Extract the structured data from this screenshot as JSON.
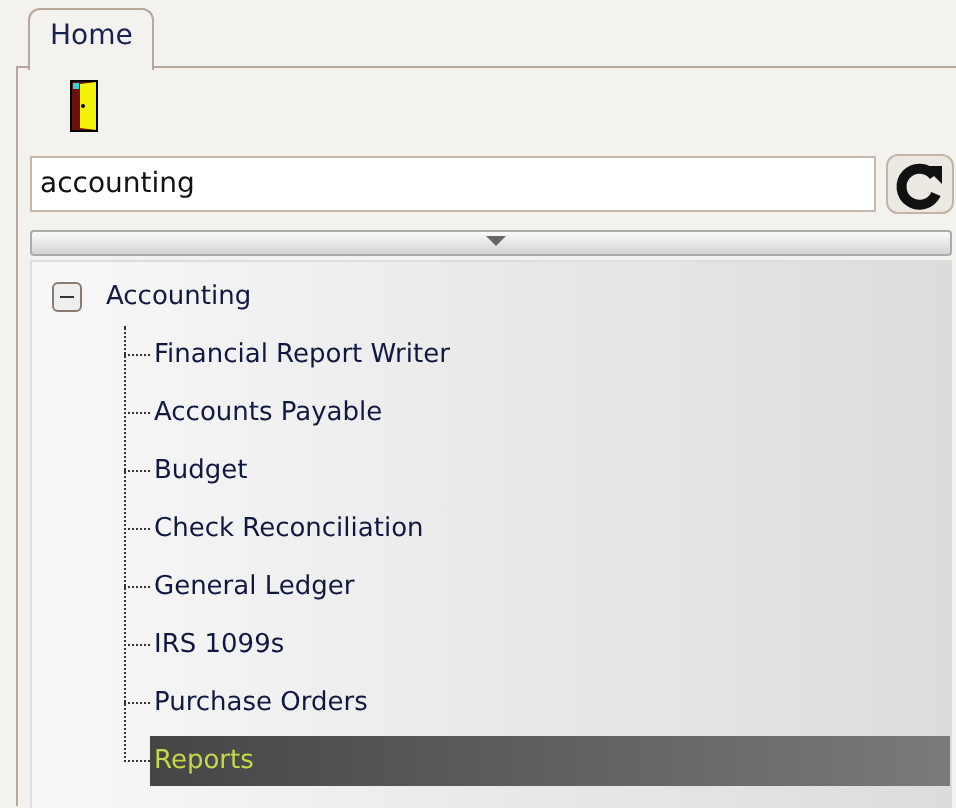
{
  "tabs": [
    {
      "label": "Home",
      "selected": true
    }
  ],
  "search": {
    "value": "accounting"
  },
  "tree": [
    {
      "label": "Accounting",
      "expanded": true,
      "selected": false,
      "children": [
        {
          "label": "Financial Report Writer",
          "selected": false
        },
        {
          "label": "Accounts Payable",
          "selected": false
        },
        {
          "label": "Budget",
          "selected": false
        },
        {
          "label": "Check Reconciliation",
          "selected": false
        },
        {
          "label": "General Ledger",
          "selected": false
        },
        {
          "label": "IRS 1099s",
          "selected": false
        },
        {
          "label": "Purchase Orders",
          "selected": false
        },
        {
          "label": "Reports",
          "selected": true
        }
      ]
    }
  ]
}
